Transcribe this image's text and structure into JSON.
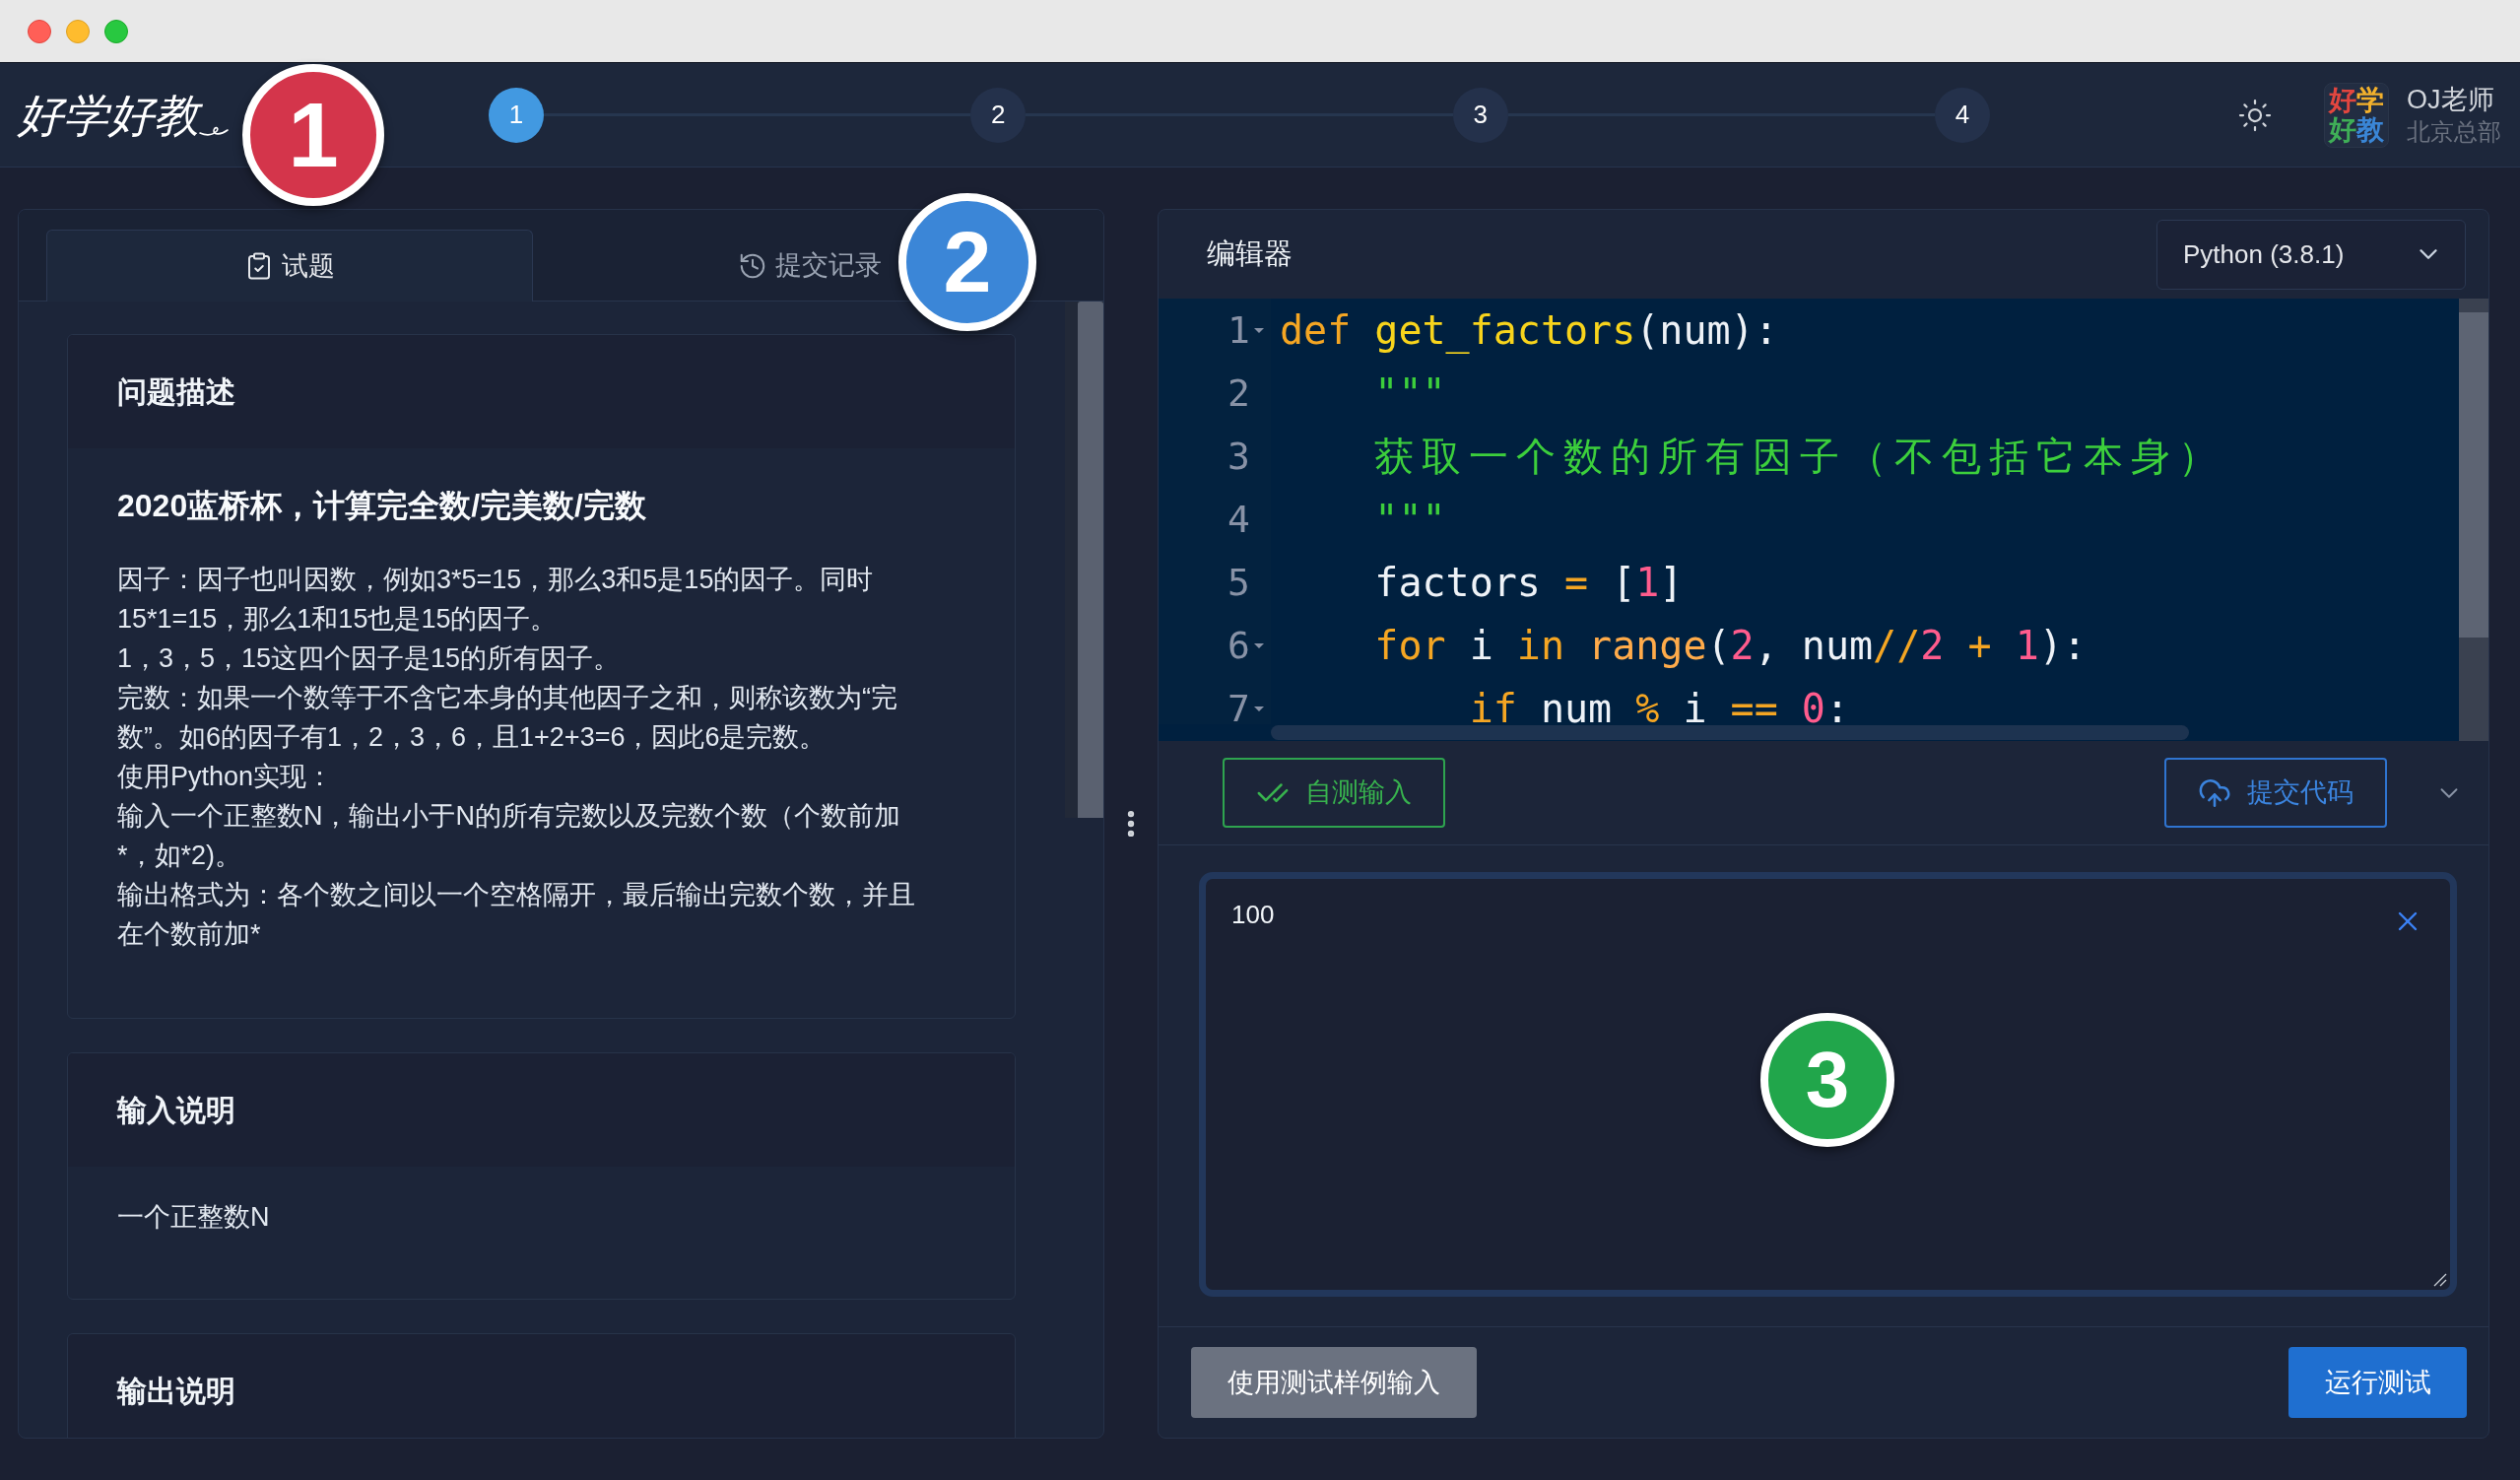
{
  "header": {
    "logo": "好学好教",
    "steps": [
      {
        "label": "1",
        "selected": true
      },
      {
        "label": "2",
        "selected": false
      },
      {
        "label": "3",
        "selected": false
      },
      {
        "label": "4",
        "selected": false
      }
    ],
    "user": {
      "avatar_logo": [
        "好学",
        "好教"
      ],
      "name": "OJ老师",
      "organization": "北京总部"
    }
  },
  "problem_panel": {
    "tabs": [
      {
        "label": "试题",
        "kind": "problem",
        "selected": true
      },
      {
        "label": "提交记录",
        "kind": "history",
        "selected": false
      }
    ],
    "sections": [
      {
        "title": "问题描述",
        "heading": "2020蓝桥杯，计算完全数/完美数/完数",
        "paragraphs": [
          [
            "因子：因子也叫因数，例如3*5=15，那么3和5是15的因子。同时",
            "15*1=15，那么1和15也是15的因子。"
          ],
          [
            "1，3，5，15这四个因子是15的所有因子。"
          ],
          [
            "完数：如果一个数等于不含它本身的其他因子之和，则称该数为“完",
            "数”。如6的因子有1，2，3，6，且1+2+3=6，因此6是完数。"
          ],
          [
            "使用Python实现："
          ],
          [
            "输入一个正整数N，输出小于N的所有完数以及完数个数（个数前加",
            "*，如*2)。"
          ],
          [
            "输出格式为：各个数之间以一个空格隔开，最后输出完数个数，并且",
            "在个数前加*"
          ]
        ]
      },
      {
        "title": "输入说明",
        "paragraphs": [
          [
            "一个正整数N"
          ]
        ]
      },
      {
        "title": "输出说明"
      }
    ]
  },
  "editor": {
    "title": "编辑器",
    "language": "Python (3.8.1)",
    "code": [
      {
        "number": "1",
        "foldable": true,
        "tokens": [
          {
            "kind": "keyword",
            "text": "def"
          },
          {
            "kind": "function",
            "text": " get_factors"
          },
          {
            "kind": "plain",
            "text": "(num):"
          }
        ]
      },
      {
        "number": "2",
        "foldable": false,
        "tokens": [
          {
            "kind": "string",
            "text": "    \"\"\""
          }
        ]
      },
      {
        "number": "3",
        "foldable": false,
        "tokens": [
          {
            "kind": "docstring",
            "text": "    获取一个数的所有因子（不包括它本身）"
          }
        ]
      },
      {
        "number": "4",
        "foldable": false,
        "tokens": [
          {
            "kind": "string",
            "text": "    \"\"\""
          }
        ]
      },
      {
        "number": "5",
        "foldable": false,
        "tokens": [
          {
            "kind": "plain",
            "text": "    factors "
          },
          {
            "kind": "operator",
            "text": "="
          },
          {
            "kind": "plain",
            "text": " ["
          },
          {
            "kind": "number",
            "text": "1"
          },
          {
            "kind": "plain",
            "text": "]"
          }
        ]
      },
      {
        "number": "6",
        "foldable": true,
        "tokens": [
          {
            "kind": "keyword",
            "text": "    for"
          },
          {
            "kind": "plain",
            "text": " i "
          },
          {
            "kind": "keyword",
            "text": "in "
          },
          {
            "kind": "builtin",
            "text": "range"
          },
          {
            "kind": "plain",
            "text": "("
          },
          {
            "kind": "number",
            "text": "2"
          },
          {
            "kind": "plain",
            "text": ", num"
          },
          {
            "kind": "operator",
            "text": "//"
          },
          {
            "kind": "number",
            "text": "2"
          },
          {
            "kind": "operator",
            "text": " + "
          },
          {
            "kind": "number",
            "text": "1"
          },
          {
            "kind": "plain",
            "text": "):"
          }
        ]
      },
      {
        "number": "7",
        "foldable": true,
        "tokens": [
          {
            "kind": "keyword",
            "text": "        if"
          },
          {
            "kind": "plain",
            "text": " num "
          },
          {
            "kind": "operator",
            "text": "%"
          },
          {
            "kind": "plain",
            "text": " i "
          },
          {
            "kind": "operator",
            "text": "=="
          },
          {
            "kind": "number",
            "text": " 0"
          },
          {
            "kind": "plain",
            "text": ":"
          }
        ]
      }
    ],
    "actions": [
      {
        "label": "自测输入",
        "kind": "test"
      },
      {
        "label": "提交代码",
        "kind": "submit"
      }
    ],
    "input": {
      "value": "100"
    },
    "buttons": [
      {
        "label": "使用测试样例输入",
        "kind": "secondary"
      },
      {
        "label": "运行测试",
        "kind": "primary"
      }
    ]
  },
  "annotations": [
    {
      "label": "1",
      "color": "#d4354b"
    },
    {
      "label": "2",
      "color": "#3b86d7"
    },
    {
      "label": "3",
      "color": "#21a64b"
    }
  ]
}
